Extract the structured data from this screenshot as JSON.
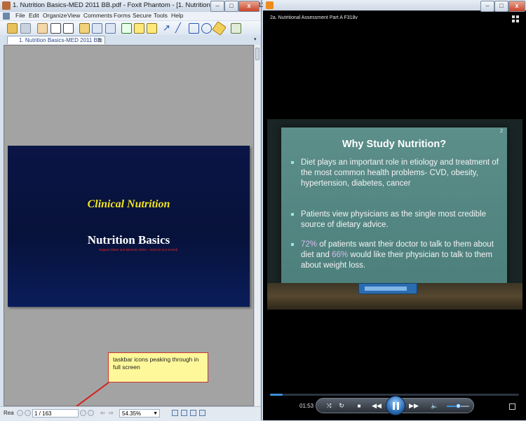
{
  "foxit": {
    "title": "1. Nutrition Basics-MED 2011 BB.pdf - Foxit Phantom - [1. Nutrition Basics-MED 2011 BB.pdf]",
    "menu": [
      "File",
      "Edit",
      "Organize",
      "View",
      "Comments",
      "Forms",
      "Secure",
      "Tools",
      "Help"
    ],
    "tab_label": "1. Nutrition Basics-MED 2011 BB",
    "slide": {
      "title": "Clinical Nutrition",
      "subtitle": "Nutrition Basics",
      "note": "skipped Water and Minerals slides - 118/142 (not tested)"
    },
    "callout_text": "taskbar icons peaking through in full screen",
    "status": {
      "ready": "Rea",
      "page_value": "1 / 163",
      "zoom_value": "54.35%"
    }
  },
  "player": {
    "title": "2a. Nutritional Assessment Part A F318v",
    "slide": {
      "number": "2",
      "title": "Why Study Nutrition?",
      "bullets": [
        {
          "text": "Diet plays an important role in etiology and treatment of the most common health problems- CVD, obesity, hypertension, diabetes, cancer"
        },
        {
          "text": "Patients view physicians as the single most credible source of dietary advice."
        },
        {
          "pct1": "72%",
          "part1": " of  patients want their doctor to talk to them about diet and ",
          "pct2": "66%",
          "part2": " would like their physician to talk to them about weight loss."
        }
      ]
    },
    "time": "01:53",
    "progress": 0.05,
    "volume": 0.5,
    "colors": {
      "accent": "#3b8ed8",
      "slide_bg": "#5c8e8a",
      "slide_title_pdf": "#f2e421"
    }
  },
  "icons": {
    "window": [
      "minimize-icon",
      "maximize-icon",
      "close-icon"
    ],
    "player_controls": [
      "shuffle-icon",
      "repeat-icon",
      "stop-icon",
      "previous-icon",
      "pause-icon",
      "next-icon",
      "volume-icon",
      "fullscreen-icon"
    ]
  }
}
